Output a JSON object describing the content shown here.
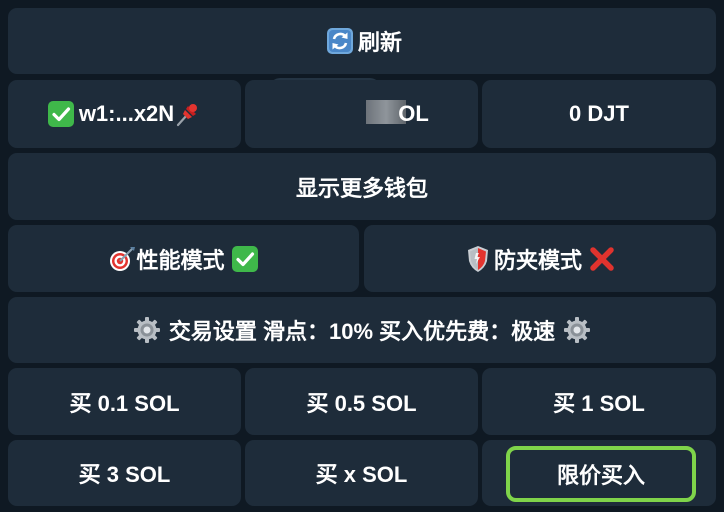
{
  "keyboard": {
    "refresh": {
      "icon": "refresh-icon",
      "label": "刷新"
    },
    "wallet": {
      "check_icon": "checkmark-icon",
      "label": "w1:...x2N",
      "pin_icon": "pushpin-icon"
    },
    "sol_balance": {
      "label": "OL"
    },
    "token_balance": {
      "label": "0 DJT"
    },
    "more_wallets": {
      "label": "显示更多钱包"
    },
    "performance_mode": {
      "icon": "target-icon",
      "label": "性能模式",
      "status_icon": "checkmark-icon"
    },
    "anti_sandwich_mode": {
      "icon": "shield-icon",
      "label": "防夹模式",
      "status_icon": "cross-icon"
    },
    "trade_settings": {
      "icon": "gear-icon",
      "label": "交易设置 滑点：10% 买入优先费：极速"
    },
    "buy_buttons": [
      {
        "label": "买 0.1 SOL"
      },
      {
        "label": "买 0.5 SOL"
      },
      {
        "label": "买 1 SOL"
      },
      {
        "label": "买 3 SOL"
      },
      {
        "label": "买 x SOL"
      }
    ],
    "limit_buy": {
      "label": "限价买入"
    }
  },
  "colors": {
    "background": "#0f1923",
    "button": "#1e2c3a",
    "text": "#ffffff",
    "highlight_border": "#7fd44a",
    "check_green": "#3fb84a",
    "cross_red": "#e0332e"
  }
}
